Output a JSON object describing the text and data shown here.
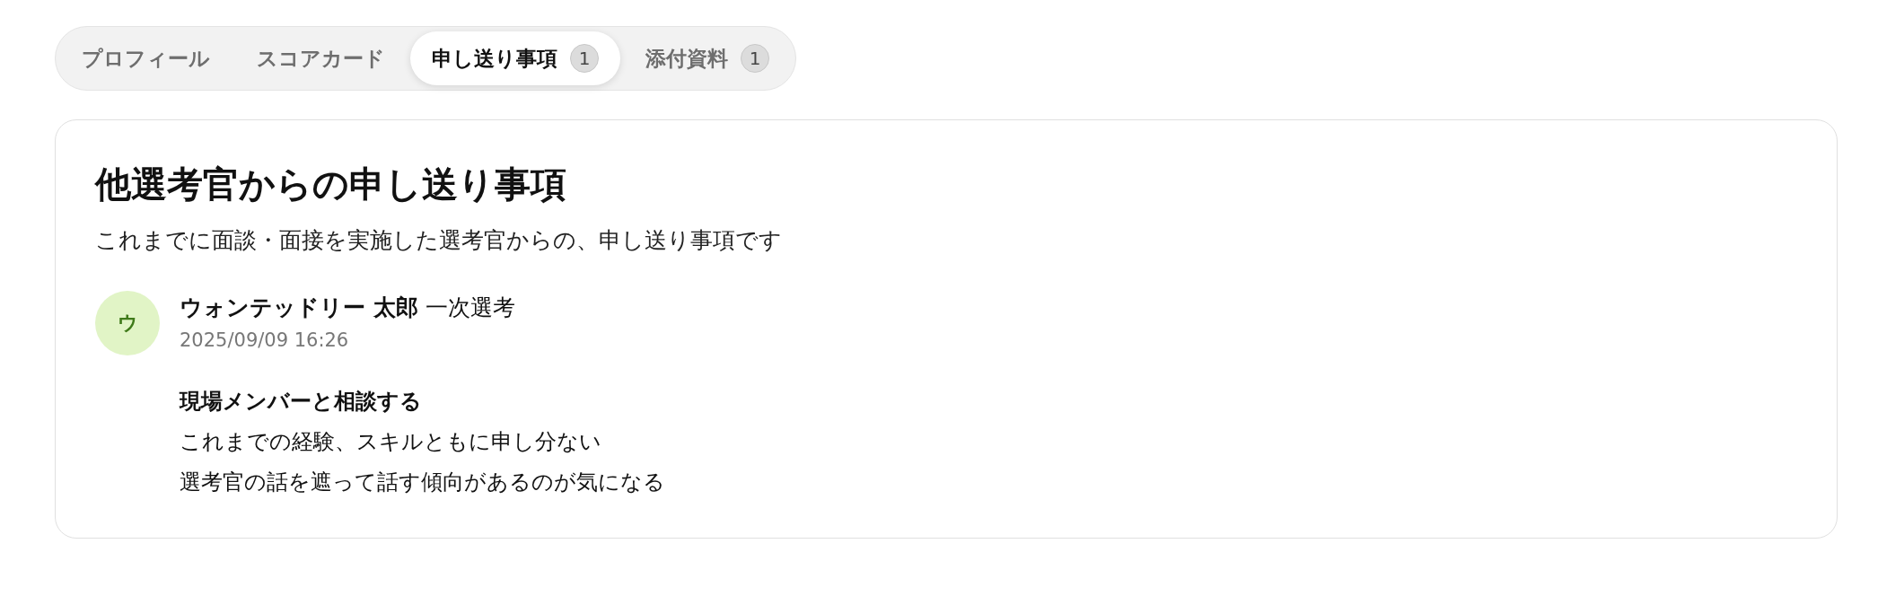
{
  "tabs": [
    {
      "label": "プロフィール",
      "selected": false
    },
    {
      "label": "スコアカード",
      "selected": false
    },
    {
      "label": "申し送り事項",
      "count": "1",
      "selected": true
    },
    {
      "label": "添付資料",
      "count": "1",
      "selected": false
    }
  ],
  "section": {
    "title": "他選考官からの申し送り事項",
    "description": "これまでに面談・面接を実施した選考官からの、申し送り事項です",
    "notes": [
      {
        "avatar": "ウ",
        "author": "ウォンテッドリー 太郎",
        "stage": "一次選考",
        "datetime": "2025/09/09 16:26",
        "heading": "現場メンバーと相談する",
        "lines": [
          "これまでの経験、スキルともに申し分ない",
          "選考官の話を遮って話す傾向があるのが気になる"
        ]
      }
    ]
  }
}
